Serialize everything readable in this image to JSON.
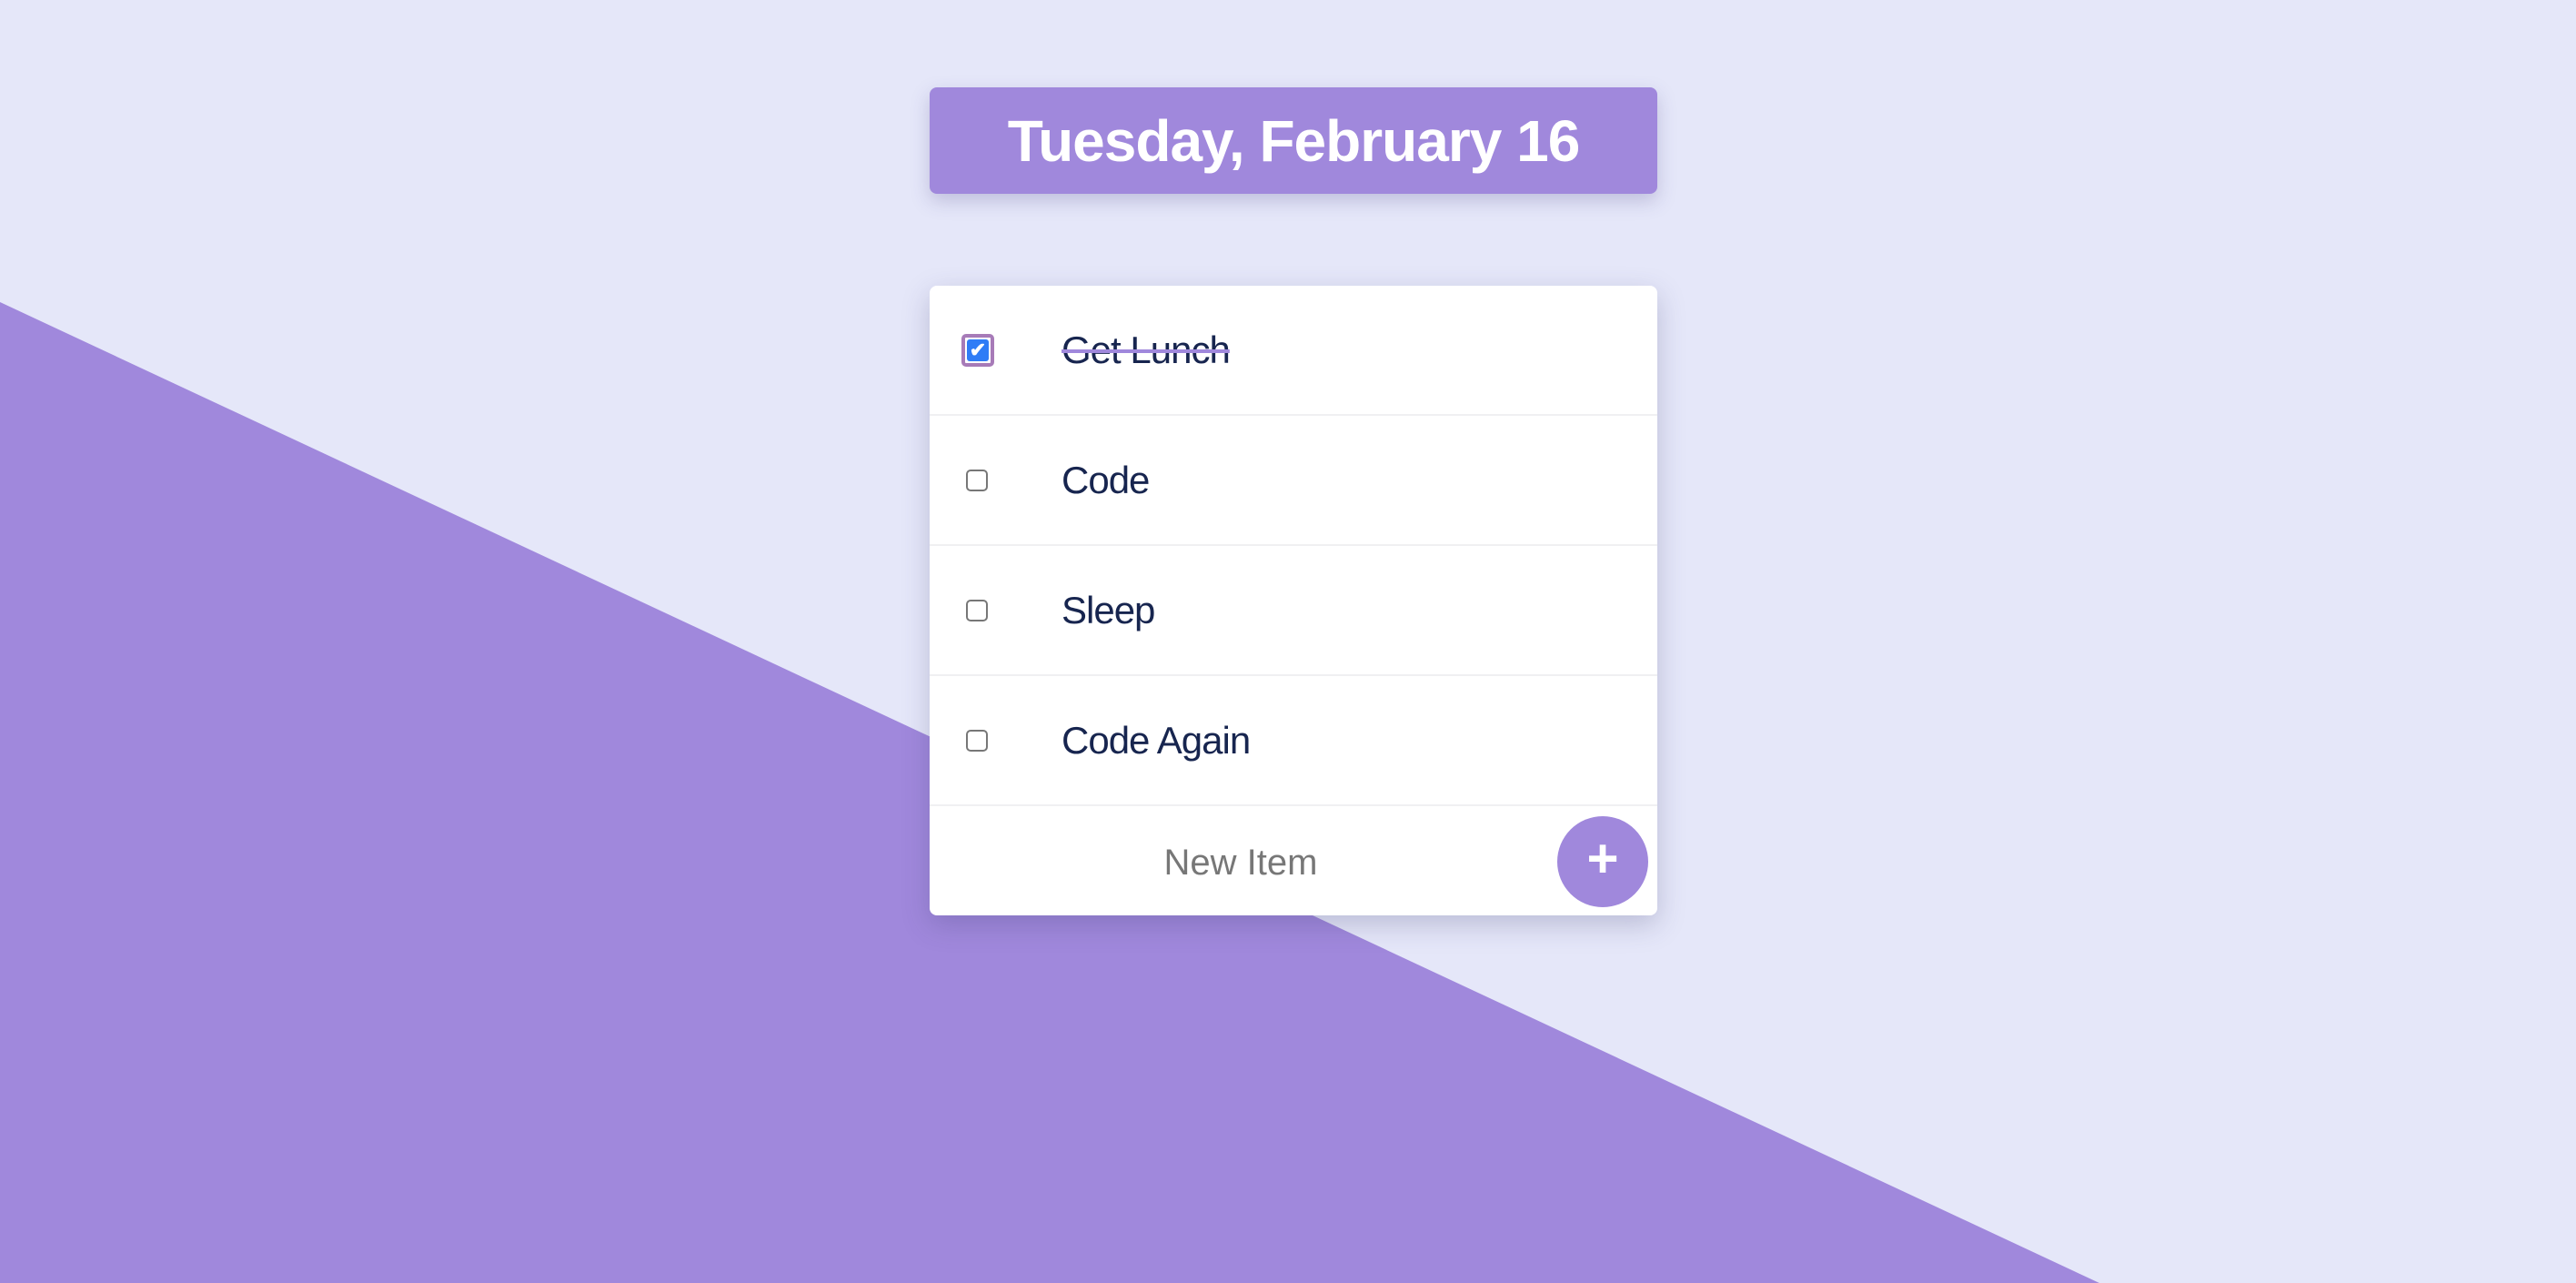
{
  "colors": {
    "background": "#e5e7f9",
    "accent": "#a088dc",
    "text": "#17254f",
    "checkbox_checked": "#2f7cf6"
  },
  "header": {
    "date": "Tuesday, February 16"
  },
  "todo": {
    "items": [
      {
        "label": "Get Lunch",
        "checked": true
      },
      {
        "label": "Code",
        "checked": false
      },
      {
        "label": "Sleep",
        "checked": false
      },
      {
        "label": "Code Again",
        "checked": false
      }
    ],
    "new_item": {
      "placeholder": "New Item",
      "value": ""
    },
    "add_button": {
      "icon": "plus-icon",
      "label": "+"
    }
  }
}
